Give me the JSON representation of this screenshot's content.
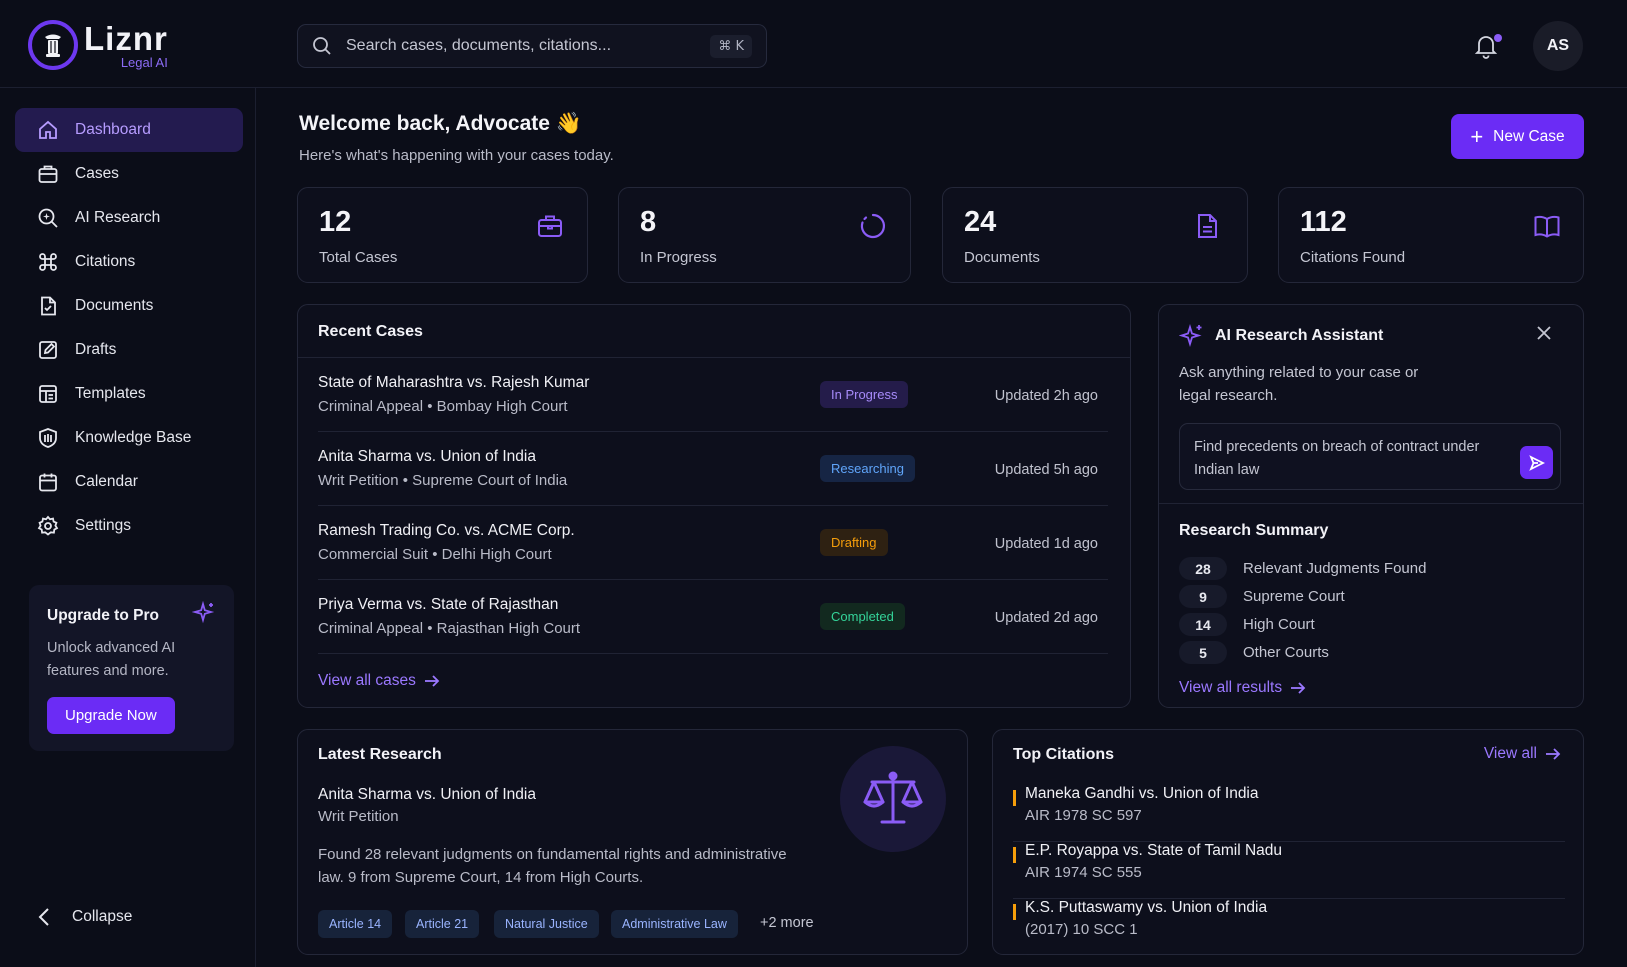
{
  "app": {
    "name": "Liznr",
    "subtitle": "Legal AI"
  },
  "search": {
    "placeholder": "Search cases, documents, citations...",
    "shortcut": "⌘ K"
  },
  "user": {
    "initials": "AS"
  },
  "sidebar": {
    "items": [
      {
        "label": "Dashboard",
        "icon": "home-icon",
        "active": true
      },
      {
        "label": "Cases",
        "icon": "briefcase-icon"
      },
      {
        "label": "AI Research",
        "icon": "search-sparkle-icon"
      },
      {
        "label": "Citations",
        "icon": "command-icon"
      },
      {
        "label": "Documents",
        "icon": "document-icon"
      },
      {
        "label": "Drafts",
        "icon": "edit-icon"
      },
      {
        "label": "Templates",
        "icon": "template-icon"
      },
      {
        "label": "Knowledge Base",
        "icon": "shield-book-icon"
      },
      {
        "label": "Calendar",
        "icon": "calendar-icon"
      },
      {
        "label": "Settings",
        "icon": "gear-icon"
      }
    ],
    "upgrade": {
      "title": "Upgrade to Pro",
      "description": "Unlock advanced AI features and more.",
      "button": "Upgrade Now"
    },
    "collapse_label": "Collapse"
  },
  "welcome": {
    "title": "Welcome back, Advocate 👋",
    "subtitle": "Here's what's happening with your cases today."
  },
  "new_case_label": "New Case",
  "stats": [
    {
      "value": "12",
      "label": "Total Cases",
      "icon": "briefcase-icon"
    },
    {
      "value": "8",
      "label": "In Progress",
      "icon": "progress-icon"
    },
    {
      "value": "24",
      "label": "Documents",
      "icon": "document-icon"
    },
    {
      "value": "112",
      "label": "Citations Found",
      "icon": "book-open-icon"
    }
  ],
  "recent_cases": {
    "title": "Recent Cases",
    "rows": [
      {
        "title": "State of Maharashtra vs. Rajesh Kumar",
        "sub": "Criminal Appeal • Bombay High Court",
        "status": "In Progress",
        "updated": "Updated 2h ago"
      },
      {
        "title": "Anita Sharma vs. Union of India",
        "sub": "Writ Petition • Supreme Court of India",
        "status": "Researching",
        "updated": "Updated 5h ago"
      },
      {
        "title": "Ramesh Trading Co. vs. ACME Corp.",
        "sub": "Commercial Suit • Delhi High Court",
        "status": "Drafting",
        "updated": "Updated 1d ago"
      },
      {
        "title": "Priya Verma vs. State of Rajasthan",
        "sub": "Criminal Appeal • Rajasthan High Court",
        "status": "Completed",
        "updated": "Updated 2d ago"
      }
    ],
    "view_all": "View all cases",
    "status_colors": {
      "In Progress": "#a78bfa",
      "Researching": "#60a5fa",
      "Drafting": "#f59e0b",
      "Completed": "#34d399"
    }
  },
  "assistant": {
    "title": "AI Research Assistant",
    "description": "Ask anything related to your case or legal research.",
    "input_value": "Find precedents on breach of contract under Indian law",
    "summary_title": "Research Summary",
    "summary": [
      {
        "count": "28",
        "label": "Relevant Judgments Found"
      },
      {
        "count": "9",
        "label": "Supreme Court"
      },
      {
        "count": "14",
        "label": "High Court"
      },
      {
        "count": "5",
        "label": "Other Courts"
      }
    ],
    "view_all": "View all results"
  },
  "latest_research": {
    "title": "Latest Research",
    "case_title": "Anita Sharma vs. Union of India",
    "case_type": "Writ Petition",
    "description_line1": "Found 28 relevant judgments on fundamental rights and administrative",
    "description_line2": "law. 9 from Supreme Court, 14 from High Courts.",
    "tags": [
      "Article 14",
      "Article 21",
      "Natural Justice",
      "Administrative Law"
    ],
    "more": "+2 more",
    "icon": "scales-icon"
  },
  "top_citations": {
    "title": "Top Citations",
    "view_all": "View all",
    "items": [
      {
        "title": "Maneka Gandhi vs. Union of India",
        "citation": "AIR 1978 SC 597"
      },
      {
        "title": "E.P. Royappa vs. State of Tamil Nadu",
        "citation": "AIR 1974 SC 555"
      },
      {
        "title": "K.S. Puttaswamy vs. Union of India",
        "citation": "(2017) 10 SCC 1"
      }
    ]
  },
  "colors": {
    "accent": "#6b2cf5",
    "accent_text": "#9b78ff",
    "background": "#0b0d18",
    "citation_bar": "#f59e0b"
  }
}
